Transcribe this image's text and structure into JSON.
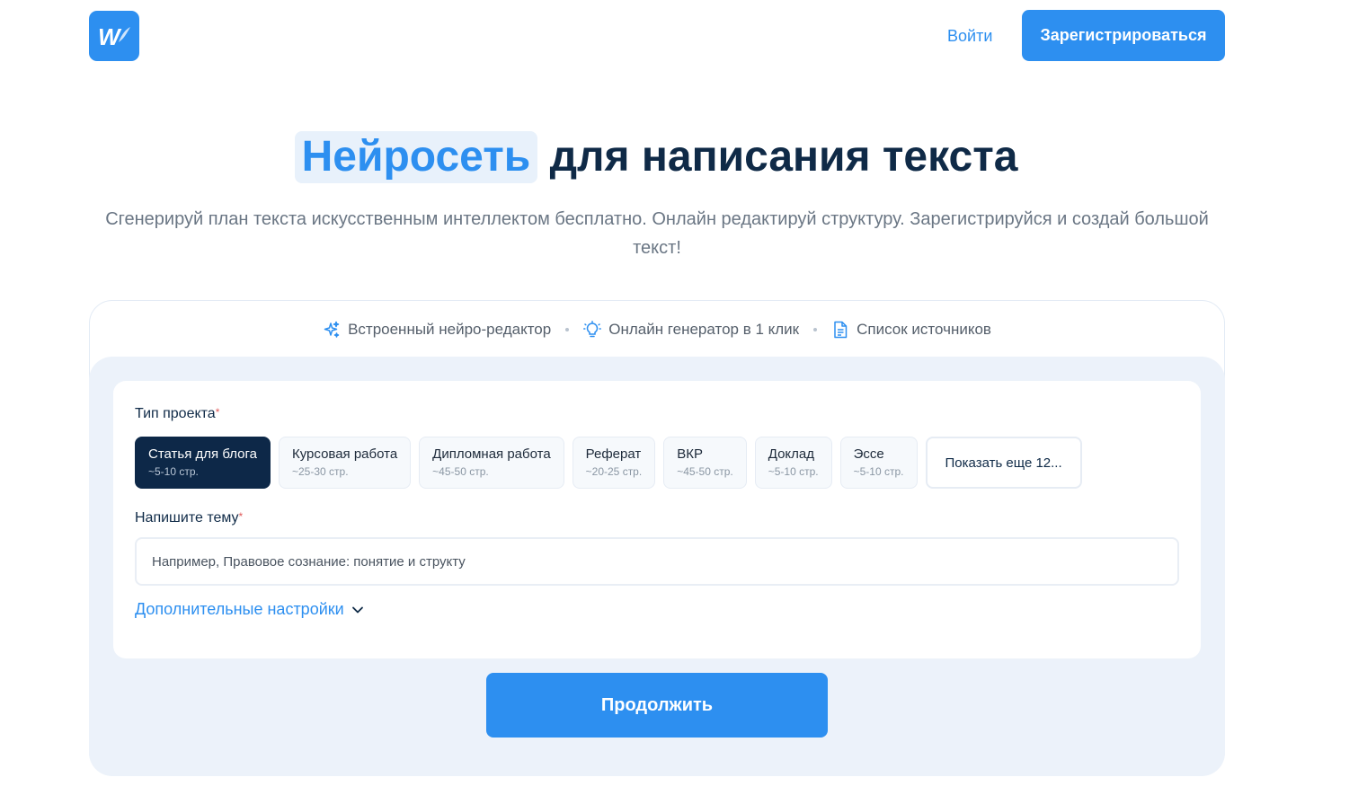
{
  "header": {
    "logo_letter": "W",
    "login_label": "Войти",
    "signup_label": "Зарегистрироваться"
  },
  "hero": {
    "title_highlight": "Нейросеть",
    "title_rest": " для написания текста",
    "subtitle": "Сгенерируй план текста искусственным интеллектом бесплатно. Онлайн редактируй структуру. Зарегистрируйся и создай большой текст!"
  },
  "features": [
    {
      "icon": "sparkles-icon",
      "label": "Встроенный нейро-редактор"
    },
    {
      "icon": "lightbulb-icon",
      "label": "Онлайн генератор в 1 клик"
    },
    {
      "icon": "document-icon",
      "label": "Список источников"
    }
  ],
  "form": {
    "project_type_label": "Тип проекта",
    "required_mark": "*",
    "project_types": [
      {
        "title": "Статья для блога",
        "pages": "~5-10 стр.",
        "active": true
      },
      {
        "title": "Курсовая работа",
        "pages": "~25-30 стр."
      },
      {
        "title": "Дипломная работа",
        "pages": "~45-50 стр."
      },
      {
        "title": "Реферат",
        "pages": "~20-25 стр."
      },
      {
        "title": "ВКР",
        "pages": "~45-50 стр."
      },
      {
        "title": "Доклад",
        "pages": "~5-10 стр."
      },
      {
        "title": "Эссе",
        "pages": "~5-10 стр."
      }
    ],
    "show_more_label": "Показать еще 12...",
    "topic_label": "Напишите тему",
    "topic_placeholder": "Например, Правовое сознание: понятие и структу",
    "topic_value": "",
    "more_settings_label": "Дополнительные настройки",
    "continue_label": "Продолжить"
  },
  "colors": {
    "accent": "#2d8ff0",
    "dark": "#0f2a47",
    "active_chip": "#0d2848",
    "panel_bg": "#ecf2fa"
  }
}
